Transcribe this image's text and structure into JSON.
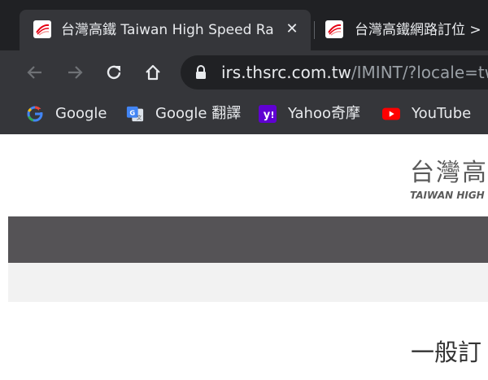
{
  "browser": {
    "tabs": [
      {
        "title": "台灣高鐵 Taiwan High Speed Ra",
        "active": true,
        "close_glyph": "✕"
      },
      {
        "title": "台灣高鐵網路訂位 >",
        "active": false
      }
    ],
    "address_bar": {
      "host": "irs.thsrc.com.tw",
      "path": "/IMINT/?locale=tw"
    },
    "bookmarks": [
      {
        "label": "Google",
        "icon": "google-icon"
      },
      {
        "label": "Google 翻譯",
        "icon": "google-translate-icon"
      },
      {
        "label": "Yahoo奇摩",
        "icon": "yahoo-icon"
      },
      {
        "label": "YouTube",
        "icon": "youtube-icon"
      }
    ]
  },
  "page": {
    "logo": {
      "chinese": "台灣高",
      "english": "TAIWAN HIGH"
    },
    "heading": "一般訂"
  },
  "colors": {
    "tabstrip": "#202124",
    "toolbar": "#35363a",
    "nav_band": "#555356",
    "sub_band": "#f2f2f2",
    "logo_text": "#5a5a5a",
    "favicon_accent": "#e60012"
  }
}
